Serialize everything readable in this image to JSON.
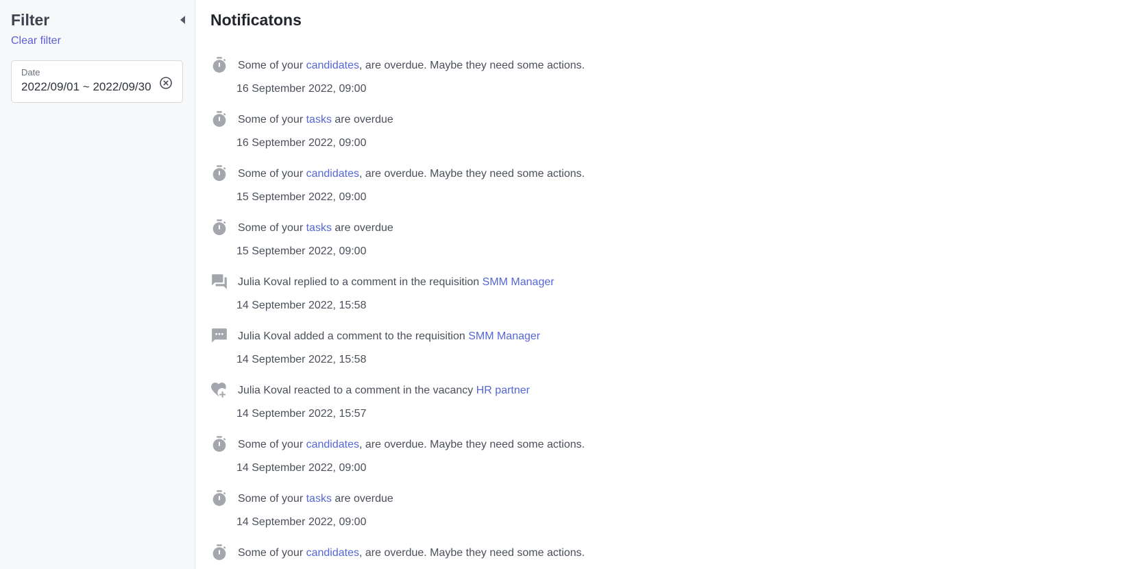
{
  "sidebar": {
    "title": "Filter",
    "clear_filter": "Clear filter",
    "date_filter": {
      "label": "Date",
      "value": "2022/09/01 ~ 2022/09/30"
    }
  },
  "main": {
    "title": "Notificatons",
    "notifications": [
      {
        "icon": "timer-icon",
        "before": "Some of your ",
        "link": "candidates",
        "after": ", are overdue. Maybe they need some actions.",
        "time": "16 September 2022, 09:00"
      },
      {
        "icon": "timer-icon",
        "before": "Some of your ",
        "link": "tasks",
        "after": " are overdue",
        "time": "16 September 2022, 09:00"
      },
      {
        "icon": "timer-icon",
        "before": "Some of your ",
        "link": "candidates",
        "after": ", are overdue. Maybe they need some actions.",
        "time": "15 September 2022, 09:00"
      },
      {
        "icon": "timer-icon",
        "before": "Some of your ",
        "link": "tasks",
        "after": " are overdue",
        "time": "15 September 2022, 09:00"
      },
      {
        "icon": "forum-icon",
        "before": "Julia Koval replied to a comment in the requisition ",
        "link": "SMM Manager",
        "after": "",
        "time": "14 September 2022, 15:58"
      },
      {
        "icon": "comment-icon",
        "before": "Julia Koval added a comment to the requisition ",
        "link": "SMM Manager",
        "after": "",
        "time": "14 September 2022, 15:58"
      },
      {
        "icon": "heart-plus-icon",
        "before": "Julia Koval reacted to a comment in the vacancy ",
        "link": "HR partner",
        "after": "",
        "time": "14 September 2022, 15:57"
      },
      {
        "icon": "timer-icon",
        "before": "Some of your ",
        "link": "candidates",
        "after": ", are overdue. Maybe they need some actions.",
        "time": "14 September 2022, 09:00"
      },
      {
        "icon": "timer-icon",
        "before": "Some of your ",
        "link": "tasks",
        "after": " are overdue",
        "time": "14 September 2022, 09:00"
      },
      {
        "icon": "timer-icon",
        "before": "Some of your ",
        "link": "candidates",
        "after": ", are overdue. Maybe they need some actions.",
        "time": ""
      }
    ]
  },
  "colors": {
    "link": "#5566d6",
    "accent": "#5a5fd6",
    "icon": "#a3a7ad"
  }
}
